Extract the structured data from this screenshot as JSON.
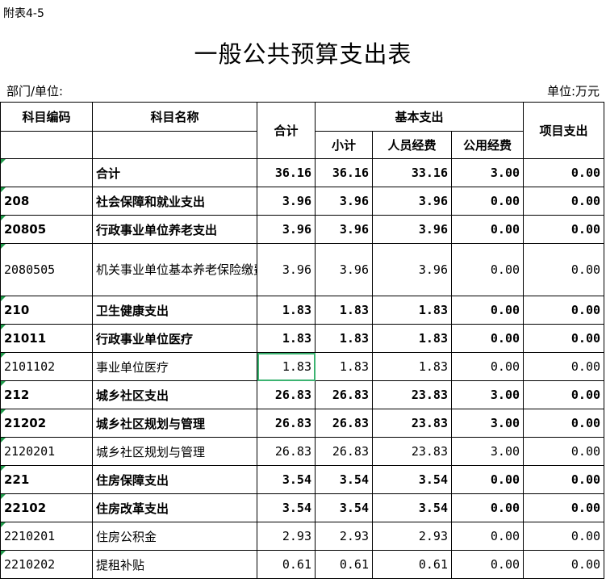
{
  "top_label": "附表4-5",
  "title": "一般公共预算支出表",
  "dept_label": "部门/单位:",
  "unit_label": "单位:万元",
  "headers": {
    "code": "科目编码",
    "name": "科目名称",
    "total": "合计",
    "basic": "基本支出",
    "subtotal": "小计",
    "personnel": "人员经费",
    "public": "公用经费",
    "project": "项目支出"
  },
  "rows": [
    {
      "code": "",
      "name": "合计",
      "total": "36.16",
      "subtotal": "36.16",
      "personnel": "33.16",
      "public": "3.00",
      "project": "0.00"
    },
    {
      "code": "208",
      "name": "社会保障和就业支出",
      "total": "3.96",
      "subtotal": "3.96",
      "personnel": "3.96",
      "public": "0.00",
      "project": "0.00"
    },
    {
      "code": "20805",
      "name": "行政事业单位养老支出",
      "total": "3.96",
      "subtotal": "3.96",
      "personnel": "3.96",
      "public": "0.00",
      "project": "0.00"
    },
    {
      "code": "2080505",
      "name": "机关事业单位基本养老保险缴费支出",
      "total": "3.96",
      "subtotal": "3.96",
      "personnel": "3.96",
      "public": "0.00",
      "project": "0.00"
    },
    {
      "code": "210",
      "name": "卫生健康支出",
      "total": "1.83",
      "subtotal": "1.83",
      "personnel": "1.83",
      "public": "0.00",
      "project": "0.00"
    },
    {
      "code": "21011",
      "name": "行政事业单位医疗",
      "total": "1.83",
      "subtotal": "1.83",
      "personnel": "1.83",
      "public": "0.00",
      "project": "0.00"
    },
    {
      "code": "2101102",
      "name": "事业单位医疗",
      "total": "1.83",
      "subtotal": "1.83",
      "personnel": "1.83",
      "public": "0.00",
      "project": "0.00"
    },
    {
      "code": "212",
      "name": "城乡社区支出",
      "total": "26.83",
      "subtotal": "26.83",
      "personnel": "23.83",
      "public": "3.00",
      "project": "0.00"
    },
    {
      "code": "21202",
      "name": "城乡社区规划与管理",
      "total": "26.83",
      "subtotal": "26.83",
      "personnel": "23.83",
      "public": "3.00",
      "project": "0.00"
    },
    {
      "code": "2120201",
      "name": "城乡社区规划与管理",
      "total": "26.83",
      "subtotal": "26.83",
      "personnel": "23.83",
      "public": "3.00",
      "project": "0.00"
    },
    {
      "code": "221",
      "name": "住房保障支出",
      "total": "3.54",
      "subtotal": "3.54",
      "personnel": "3.54",
      "public": "0.00",
      "project": "0.00"
    },
    {
      "code": "22102",
      "name": "住房改革支出",
      "total": "3.54",
      "subtotal": "3.54",
      "personnel": "3.54",
      "public": "0.00",
      "project": "0.00"
    },
    {
      "code": "2210201",
      "name": "住房公积金",
      "total": "2.93",
      "subtotal": "2.93",
      "personnel": "2.93",
      "public": "0.00",
      "project": "0.00"
    },
    {
      "code": "2210202",
      "name": "提租补贴",
      "total": "0.61",
      "subtotal": "0.61",
      "personnel": "0.61",
      "public": "0.00",
      "project": "0.00"
    }
  ]
}
